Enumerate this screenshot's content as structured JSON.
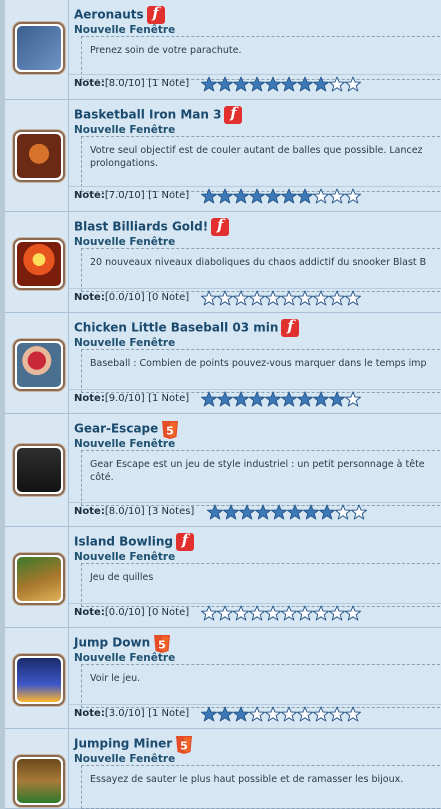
{
  "games": [
    {
      "title": "Aeronauts",
      "tech": "flash",
      "subtitle": "Nouvelle Fenêtre",
      "desc": "Prenez soin de votre parachute.",
      "note_label": "Note",
      "note_value": "[8.0/10]",
      "note_count": "[1 Note]",
      "rating": 8,
      "thumb_icon": "aeronauts-game-thumbnail"
    },
    {
      "title": "Basketball Iron Man 3",
      "tech": "flash",
      "subtitle": "Nouvelle Fenêtre",
      "desc": "Votre seul objectif est de couler autant de balles que possible. Lancez prolongations.",
      "note_label": "Note",
      "note_value": "[7.0/10]",
      "note_count": "[1 Note]",
      "rating": 7,
      "thumb_icon": "basketball-game-thumbnail"
    },
    {
      "title": "Blast Billiards Gold!",
      "tech": "flash",
      "subtitle": "Nouvelle Fenêtre",
      "desc": "20 nouveaux niveaux diaboliques du chaos addictif du snooker Blast B",
      "note_label": "Note",
      "note_value": "[0.0/10]",
      "note_count": "[0 Note]",
      "rating": 0,
      "thumb_icon": "billiards-game-thumbnail"
    },
    {
      "title": "Chicken Little Baseball 03 min",
      "tech": "flash",
      "subtitle": "Nouvelle Fenêtre",
      "desc": "Baseball : Combien de points pouvez-vous marquer dans le temps imp",
      "note_label": "Note",
      "note_value": "[9.0/10]",
      "note_count": "[1 Note]",
      "rating": 9,
      "thumb_icon": "baseball-game-thumbnail"
    },
    {
      "title": "Gear-Escape",
      "tech": "html5",
      "subtitle": "Nouvelle Fenêtre",
      "desc": "Gear Escape est un jeu de style industriel : un petit personnage à tête côté.",
      "note_label": "Note",
      "note_value": "[8.0/10]",
      "note_count": "[3 Notes]",
      "rating": 8,
      "thumb_icon": "gear-escape-game-thumbnail"
    },
    {
      "title": "Island Bowling",
      "tech": "flash",
      "subtitle": "Nouvelle Fenêtre",
      "desc": "Jeu de quilles",
      "note_label": "Note",
      "note_value": "[0.0/10]",
      "note_count": "[0 Note]",
      "rating": 0,
      "thumb_icon": "bowling-game-thumbnail"
    },
    {
      "title": "Jump Down",
      "tech": "html5",
      "subtitle": "Nouvelle Fenêtre",
      "desc": "Voir le jeu.",
      "note_label": "Note",
      "note_value": "[3.0/10]",
      "note_count": "[1 Note]",
      "rating": 3,
      "thumb_icon": "jump-down-game-thumbnail"
    },
    {
      "title": "Jumping Miner",
      "tech": "html5",
      "subtitle": "Nouvelle Fenêtre",
      "desc": "Essayez de sauter le plus haut possible et de ramasser les bijoux.",
      "note_label": "",
      "note_value": "",
      "note_count": "",
      "rating": 0,
      "thumb_icon": "jumping-miner-game-thumbnail"
    }
  ],
  "stars_total": 10,
  "colors": {
    "star_filled": "#3d78b7",
    "star_empty": "#ffffff",
    "star_stroke": "#2a5a8c",
    "flash_badge": "#e2302f",
    "html5_badge": "#e44d26",
    "title": "#1a4a6e"
  }
}
